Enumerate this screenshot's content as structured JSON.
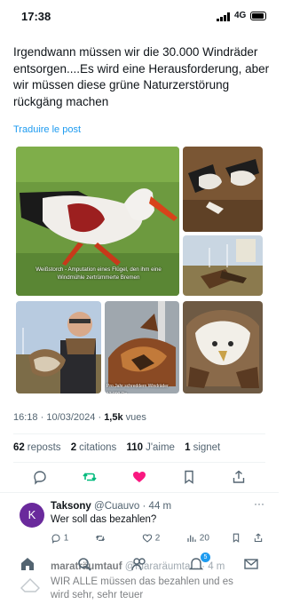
{
  "status_bar": {
    "time": "17:38",
    "network": "4G",
    "battery_level": 0.9
  },
  "post": {
    "text": "Irgendwann müssen wir die 30.000 Windräder entsorgen....Es wird eine Herausforderung, aber wir müssen diese grüne Naturzerstörung rückgäng machen",
    "translate_label": "Traduire le post",
    "media_caption_1": "Weißstorch - Amputation eines Flügel, den ihm eine Windmühle zertrümmerte Bremen",
    "media_caption_2": "Pro Jahr schreddern Windräder 12.000 Ro",
    "time": "16:18",
    "separator": "·",
    "date": "10/03/2024",
    "views_count": "1,5k",
    "views_label": "vues"
  },
  "stats": {
    "reposts_count": "62",
    "reposts_label": "reposts",
    "citations_count": "2",
    "citations_label": "citations",
    "likes_count": "110",
    "likes_label": "J'aime",
    "bookmarks_count": "1",
    "bookmarks_label": "signet"
  },
  "reply": {
    "avatar_letter": "K",
    "name": "Taksony",
    "handle": "@Cuauvo · 44 m",
    "text": "Wer soll das bezahlen?",
    "reply_count": "1",
    "like_count": "2",
    "views_count": "20",
    "more": "···"
  },
  "reply2": {
    "name": "maraträumtauf",
    "handle": "@mararäumta... · 4 m",
    "text": "WIR ALLE müssen das bezahlen und es wird sehr, sehr teuer"
  },
  "nav": {
    "notifications_badge": "5"
  },
  "colors": {
    "accent": "#1d9bf0",
    "repost_green": "#00ba7c",
    "like_pink": "#f91880",
    "avatar": "#6a2a9c"
  }
}
